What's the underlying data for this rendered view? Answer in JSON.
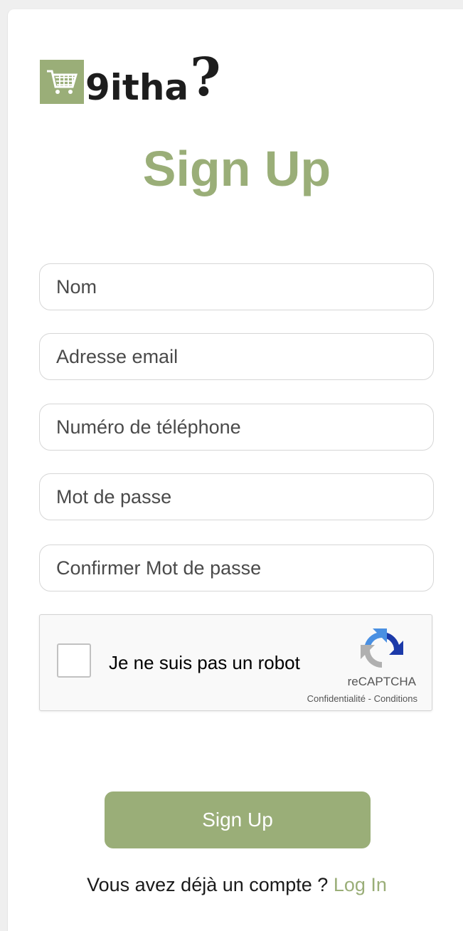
{
  "brand": {
    "name": "9itha",
    "mark": "?",
    "icon": "shopping-cart-icon",
    "accent_color": "#9aae78"
  },
  "form": {
    "title": "Sign Up",
    "fields": {
      "name": {
        "placeholder": "Nom",
        "value": ""
      },
      "email": {
        "placeholder": "Adresse email",
        "value": ""
      },
      "phone": {
        "placeholder": "Numéro de téléphone",
        "value": ""
      },
      "password": {
        "placeholder": "Mot de passe",
        "value": ""
      },
      "confirm_password": {
        "placeholder": "Confirmer Mot de passe",
        "value": ""
      }
    },
    "captcha": {
      "label": "Je ne suis pas un robot",
      "brand": "reCAPTCHA",
      "privacy": "Confidentialité",
      "separator": " - ",
      "terms": "Conditions",
      "checked": false
    },
    "submit_label": "Sign Up",
    "login_prompt": "Vous avez déjà un compte ? ",
    "login_link": "Log In"
  }
}
